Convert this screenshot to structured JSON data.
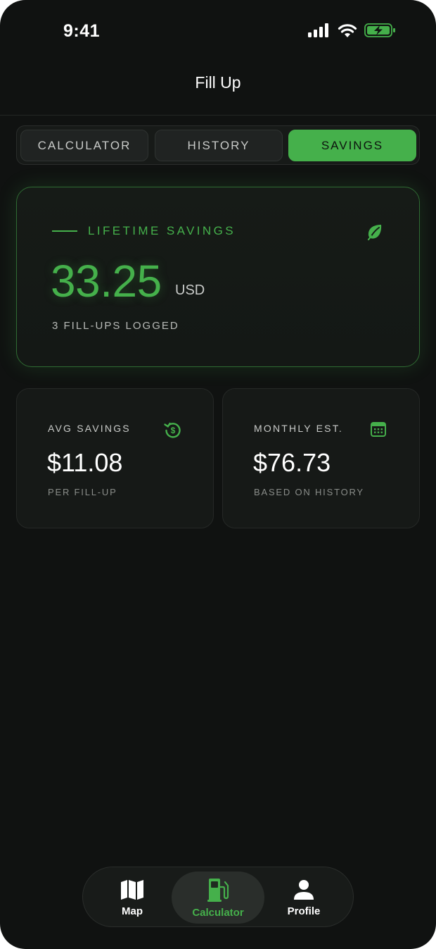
{
  "status_bar": {
    "time": "9:41"
  },
  "header": {
    "title": "Fill Up"
  },
  "segments": [
    {
      "label": "CALCULATOR",
      "selected": false
    },
    {
      "label": "HISTORY",
      "selected": false
    },
    {
      "label": "SAVINGS",
      "selected": true
    }
  ],
  "lifetime": {
    "label": "LIFETIME SAVINGS",
    "amount": "33.25",
    "currency": "USD",
    "count_text": "3 FILL-UPS LOGGED",
    "icon": "leaf-icon"
  },
  "stats": [
    {
      "label": "AVG SAVINGS",
      "value": "$11.08",
      "sub": "PER FILL-UP",
      "icon": "dollar-refresh-icon"
    },
    {
      "label": "MONTHLY EST.",
      "value": "$76.73",
      "sub": "BASED ON HISTORY",
      "icon": "calendar-icon"
    }
  ],
  "tabbar": {
    "items": [
      {
        "label": "Map",
        "icon": "map-icon",
        "active": false
      },
      {
        "label": "Calculator",
        "icon": "fuel-pump-icon",
        "active": true
      },
      {
        "label": "Profile",
        "icon": "person-icon",
        "active": false
      }
    ]
  },
  "colors": {
    "accent": "#45b04b",
    "background": "#101211",
    "card": "#161917",
    "text_muted": "#8a8d8a"
  }
}
